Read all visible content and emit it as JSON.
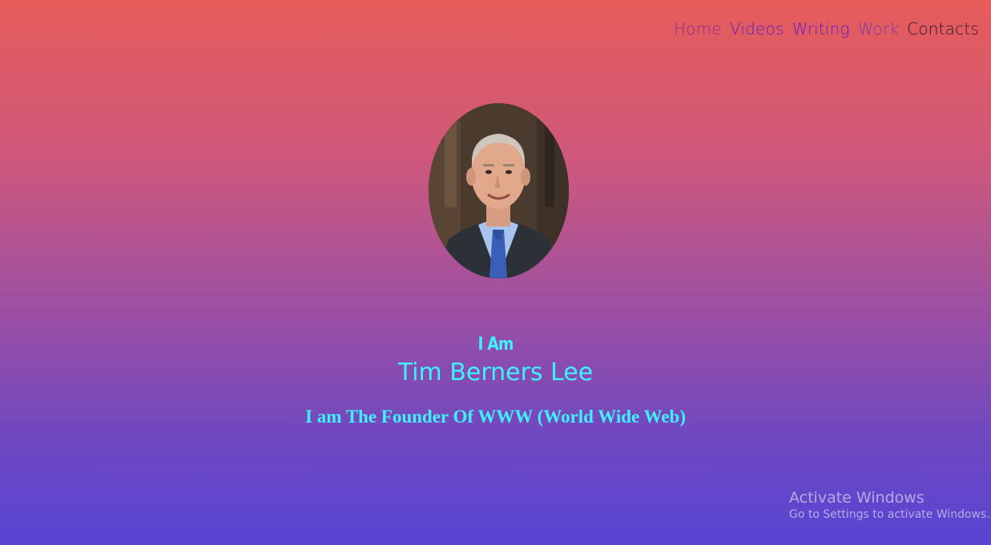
{
  "nav": {
    "items": [
      {
        "label": "Home",
        "color": "#8e2f8e"
      },
      {
        "label": "Videos",
        "color": "#5b1ed0"
      },
      {
        "label": "Writing",
        "color": "#5b1ed0"
      },
      {
        "label": "Work",
        "color": "#7b3aa8"
      },
      {
        "label": "Contacts",
        "color": "#2a1a2a"
      }
    ]
  },
  "hero": {
    "intro": "I Am",
    "name": "Tim Berners Lee",
    "tagline": "I am The Founder Of WWW (World Wide Web)",
    "accent_color": "#3ff1ff",
    "portrait_icon": "portrait-photo"
  },
  "watermark": {
    "title": "Activate Windows",
    "subtitle": "Go to Settings to activate Windows."
  },
  "colors": {
    "gradient_top": "#e65c5a",
    "gradient_bottom": "#5844d4"
  }
}
